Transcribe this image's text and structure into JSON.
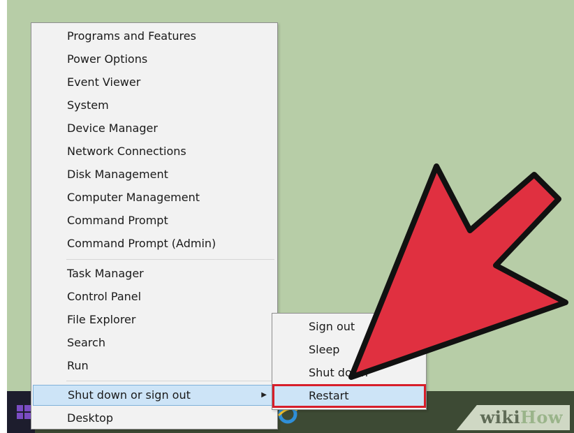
{
  "context_menu": {
    "group1": [
      "Programs and Features",
      "Power Options",
      "Event Viewer",
      "System",
      "Device Manager",
      "Network Connections",
      "Disk Management",
      "Computer Management",
      "Command Prompt",
      "Command Prompt (Admin)"
    ],
    "group2": [
      "Task Manager",
      "Control Panel",
      "File Explorer",
      "Search",
      "Run"
    ],
    "shutdown_label": "Shut down or sign out",
    "desktop_label": "Desktop"
  },
  "submenu": {
    "items": [
      "Sign out",
      "Sleep",
      "Shut down",
      "Restart"
    ]
  },
  "watermark": {
    "part1": "wiki",
    "part2": "How"
  },
  "icons": {
    "submenu_arrow": "chevron-right-icon",
    "annotation": "red-pointer-arrow"
  },
  "colors": {
    "desktop_bg": "#b7cda7",
    "menu_bg": "#f2f2f2",
    "highlight_bg": "#cde4f7",
    "highlight_border": "#7fb1d9",
    "selection_outline": "#d71e2a",
    "arrow_fill": "#e03040"
  }
}
